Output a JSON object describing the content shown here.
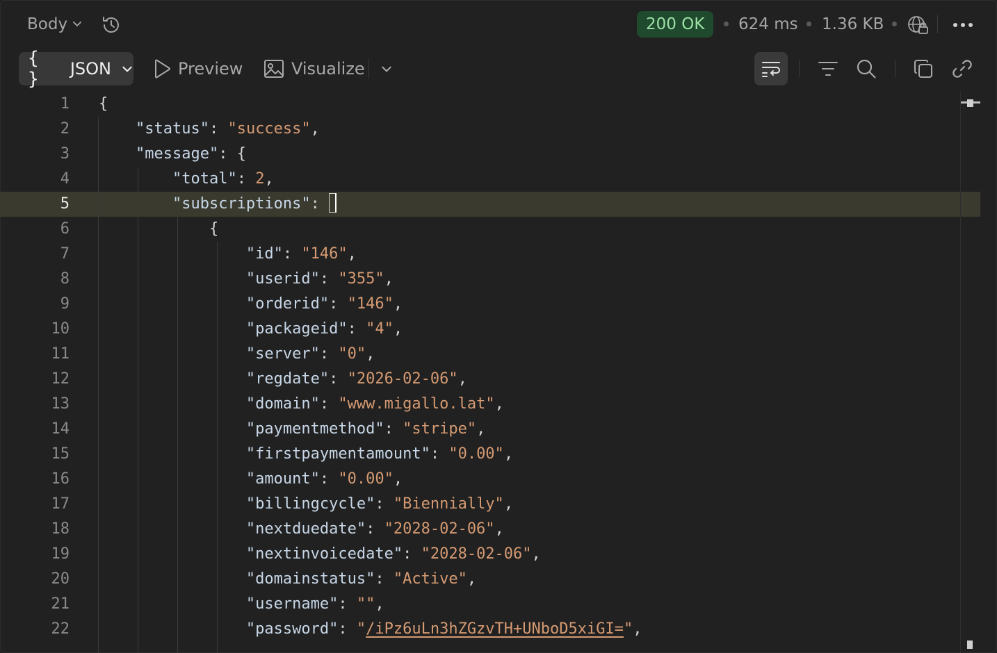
{
  "topbar": {
    "body_label": "Body",
    "status": "200 OK",
    "time": "624 ms",
    "size": "1.36 KB"
  },
  "toolbar": {
    "format_brace": "{ }",
    "format_label": "JSON",
    "preview_label": "Preview",
    "visualize_label": "Visualize"
  },
  "colors": {
    "status_bg": "#1f4a2d",
    "status_text": "#9de0a7",
    "string_value": "#d59a72",
    "active_line": "#3a3a2e"
  },
  "icons": [
    "chevron-down-icon",
    "history-icon",
    "globe-lock-icon",
    "more-icon",
    "play-icon",
    "image-icon",
    "word-wrap-icon",
    "filter-icon",
    "search-icon",
    "copy-icon",
    "link-icon"
  ],
  "editor": {
    "active_line": 5,
    "lines": [
      {
        "n": "1",
        "code": "{"
      },
      {
        "n": "2",
        "code": "    \"status\": \"success\","
      },
      {
        "n": "3",
        "code": "    \"message\": {"
      },
      {
        "n": "4",
        "code": "        \"total\": 2,"
      },
      {
        "n": "5",
        "code": "        \"subscriptions\": ["
      },
      {
        "n": "6",
        "code": "            {"
      },
      {
        "n": "7",
        "code": "                \"id\": \"146\","
      },
      {
        "n": "8",
        "code": "                \"userid\": \"355\","
      },
      {
        "n": "9",
        "code": "                \"orderid\": \"146\","
      },
      {
        "n": "10",
        "code": "                \"packageid\": \"4\","
      },
      {
        "n": "11",
        "code": "                \"server\": \"0\","
      },
      {
        "n": "12",
        "code": "                \"regdate\": \"2026-02-06\","
      },
      {
        "n": "13",
        "code": "                \"domain\": \"www.migallo.lat\","
      },
      {
        "n": "14",
        "code": "                \"paymentmethod\": \"stripe\","
      },
      {
        "n": "15",
        "code": "                \"firstpaymentamount\": \"0.00\","
      },
      {
        "n": "16",
        "code": "                \"amount\": \"0.00\","
      },
      {
        "n": "17",
        "code": "                \"billingcycle\": \"Biennially\","
      },
      {
        "n": "18",
        "code": "                \"nextduedate\": \"2028-02-06\","
      },
      {
        "n": "19",
        "code": "                \"nextinvoicedate\": \"2028-02-06\","
      },
      {
        "n": "20",
        "code": "                \"domainstatus\": \"Active\","
      },
      {
        "n": "21",
        "code": "                \"username\": \"\","
      },
      {
        "n": "22",
        "code": "                \"password\": \"/iPz6uLn3hZGzvTH+UNboD5xiGI=\","
      }
    ]
  }
}
